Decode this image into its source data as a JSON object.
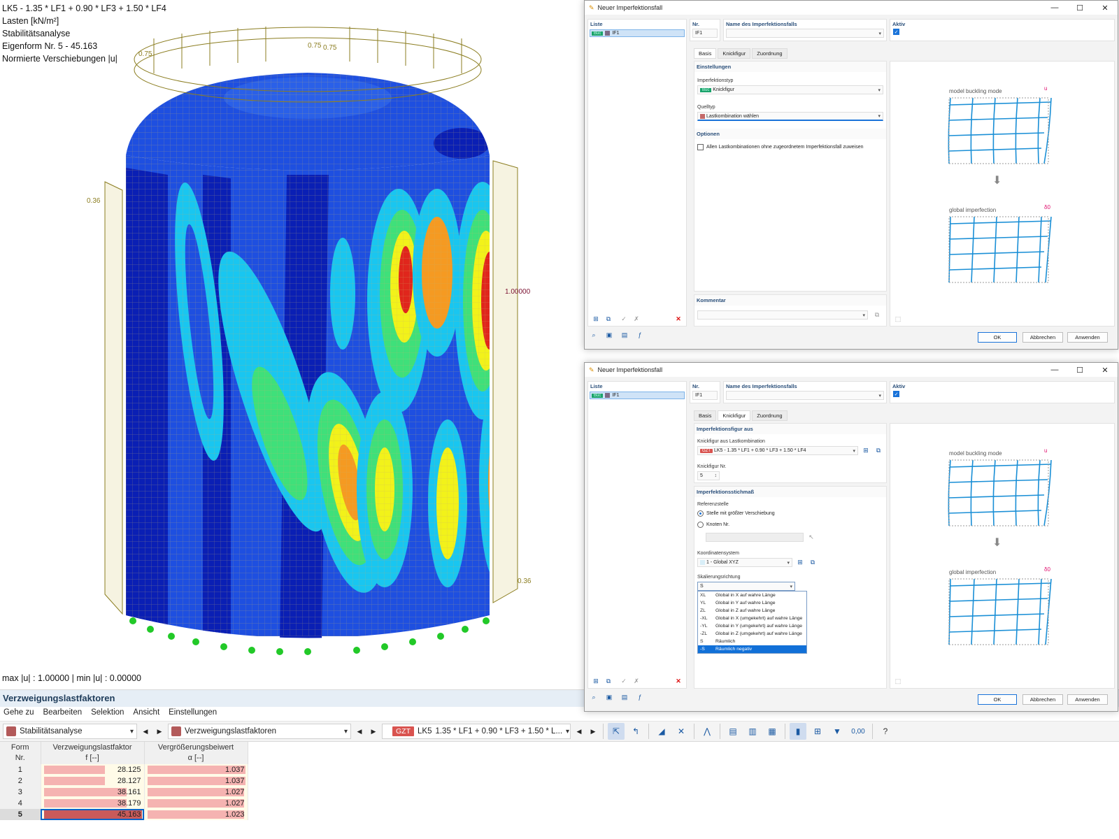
{
  "viewport": {
    "info_lines": [
      "LK5 - 1.35 * LF1 + 0.90 * LF3 + 1.50 * LF4",
      "Lasten [kN/m²]",
      "Stabilitätsanalyse",
      "Eigenform Nr. 5 - 45.163",
      "Normierte Verschiebungen |u|"
    ],
    "minmax": "max |u| : 1.00000 | min |u| : 0.00000",
    "value_labels": {
      "v075a": "0.75",
      "v075b": "0.75",
      "v075c": "0.75",
      "v036a": "0.36",
      "v036b": "0.36",
      "vmax": "1.00000"
    },
    "colors": {
      "deep_blue": "#0a1fb4",
      "blue": "#1e4fe0",
      "cyan": "#19c6f0",
      "green": "#3fe07a",
      "yellow": "#f2f21a",
      "orange": "#f59a22",
      "red": "#e0261c",
      "support_green": "#22c928",
      "load_olive": "#8b7d20"
    }
  },
  "panel": {
    "title": "Verzweigungslastfaktoren",
    "menu": [
      "Gehe zu",
      "Bearbeiten",
      "Selektion",
      "Ansicht",
      "Einstellungen"
    ],
    "toolbar": {
      "analysis_select": "Stabilitätsanalyse",
      "table_select": "Verzweigungslastfaktoren",
      "combo_badge": "GZT",
      "combo_id": "LK5",
      "combo_formula": "1.35 * LF1 + 0.90 * LF3 + 1.50 * L...",
      "zero_label": "0,00"
    },
    "columns": {
      "form_top": "Form",
      "form_bottom": "Nr.",
      "f_top": "Verzweigungslastfaktor",
      "f_bottom": "f [--]",
      "a_top": "Vergrößerungsbeiwert",
      "a_bottom": "α [--]"
    },
    "rows": [
      {
        "no": "1",
        "f": "28.125",
        "a": "1.037",
        "f_val": 28.125,
        "a_val": 1.037
      },
      {
        "no": "2",
        "f": "28.127",
        "a": "1.037",
        "f_val": 28.127,
        "a_val": 1.037
      },
      {
        "no": "3",
        "f": "38.161",
        "a": "1.027",
        "f_val": 38.161,
        "a_val": 1.027
      },
      {
        "no": "4",
        "f": "38.179",
        "a": "1.027",
        "f_val": 38.179,
        "a_val": 1.027
      },
      {
        "no": "5",
        "f": "45.163",
        "a": "1.023",
        "f_val": 45.163,
        "a_val": 1.023
      }
    ],
    "selected_row": "5"
  },
  "dialog1": {
    "title": "Neuer Imperfektionsfall",
    "list_header": "Liste",
    "list_item_badge": "Buc",
    "list_item_label": "IF1",
    "nr_label": "Nr.",
    "nr_value": "IF1",
    "name_label": "Name des Imperfektionsfalls",
    "active_label": "Aktiv",
    "tabs": [
      "Basis",
      "Knickfigur",
      "Zuordnung"
    ],
    "settings_header": "Einstellungen",
    "imptype_label": "Imperfektionstyp",
    "imptype_badge": "Buc",
    "imptype_value": "Knickfigur",
    "source_label": "Quelltyp",
    "source_value": "Lastkombination wählen",
    "options_header": "Optionen",
    "options_checkbox": "Allen Lastkombinationen ohne zugeordnetem Imperfektionsfall zuweisen",
    "comment_header": "Kommentar",
    "fig_top": "model buckling mode",
    "fig_top_sym": "u",
    "fig_bottom": "global imperfection",
    "fig_bottom_sym": "δ0",
    "btn_ok": "OK",
    "btn_cancel": "Abbrechen",
    "btn_apply": "Anwenden"
  },
  "dialog2": {
    "title": "Neuer Imperfektionsfall",
    "list_header": "Liste",
    "list_item_badge": "Buc",
    "list_item_label": "IF1",
    "nr_label": "Nr.",
    "nr_value": "IF1",
    "name_label": "Name des Imperfektionsfalls",
    "active_label": "Aktiv",
    "tabs": [
      "Basis",
      "Knickfigur",
      "Zuordnung"
    ],
    "shape_header": "Imperfektionsfigur aus",
    "shape_combo_label": "Knickfigur aus Lastkombination",
    "shape_combo_badge": "GZT",
    "shape_combo_value": "LK5 - 1.35 * LF1 + 0.90 * LF3 + 1.50 * LF4",
    "mode_no_label": "Knickfigur Nr.",
    "mode_no_value": "5",
    "amp_header": "Imperfektionsstichmaß",
    "ref_label": "Referenzstelle",
    "ref_opt1": "Stelle mit größter Verschiebung",
    "ref_opt2": "Knoten Nr.",
    "cs_label": "Koordinatensystem",
    "cs_value": "1 - Global XYZ",
    "scale_label": "Skalierungsrichtung",
    "scale_value": "S",
    "scale_options": [
      {
        "code": "XL",
        "text": "Global in X auf wahre Länge"
      },
      {
        "code": "YL",
        "text": "Global in Y auf wahre Länge"
      },
      {
        "code": "ZL",
        "text": "Global in Z auf wahre Länge"
      },
      {
        "code": "-XL",
        "text": "Global in X (umgekehrt) auf wahre Länge"
      },
      {
        "code": "-YL",
        "text": "Global in Y (umgekehrt) auf wahre Länge"
      },
      {
        "code": "-ZL",
        "text": "Global in Z (umgekehrt) auf wahre Länge"
      },
      {
        "code": "S",
        "text": "Räumlich"
      },
      {
        "code": "-S",
        "text": "Räumlich negativ"
      }
    ],
    "fig_top": "model buckling mode",
    "fig_top_sym": "u",
    "fig_bottom": "global imperfection",
    "fig_bottom_sym": "δ0",
    "btn_ok": "OK",
    "btn_cancel": "Abbrechen",
    "btn_apply": "Anwenden"
  }
}
